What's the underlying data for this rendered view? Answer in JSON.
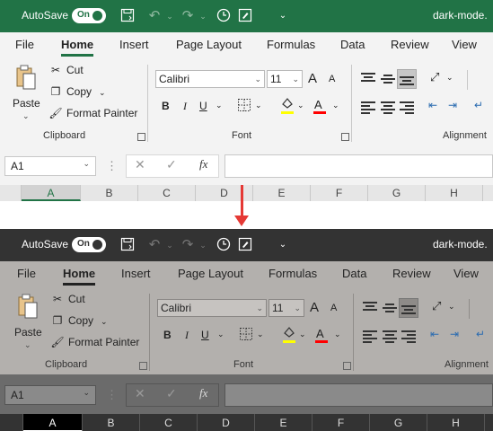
{
  "titlebar": {
    "autosave_label": "AutoSave",
    "toggle_state": "On",
    "doc_title": "dark-mode.",
    "icons": [
      "save-icon",
      "undo-icon",
      "redo-icon",
      "autorecover-clock-icon",
      "form-icon",
      "customize-qat-icon"
    ]
  },
  "tabs": [
    "File",
    "Home",
    "Insert",
    "Page Layout",
    "Formulas",
    "Data",
    "Review",
    "View"
  ],
  "active_tab": "Home",
  "clipboard": {
    "paste_label": "Paste",
    "cut_label": "Cut",
    "copy_label": "Copy",
    "format_painter_label": "Format Painter",
    "group_label": "Clipboard"
  },
  "font": {
    "font_name": "Calibri",
    "font_size": "11",
    "bold": "B",
    "italic": "I",
    "underline": "U",
    "group_label": "Font",
    "highlight_color": "#ffff00",
    "font_color": "#ff0000",
    "grow": "A",
    "shrink": "A"
  },
  "alignment": {
    "group_label": "Alignment"
  },
  "formula_bar": {
    "name_box": "A1",
    "fx": "fx",
    "cancel": "✕",
    "enter": "✓",
    "dots": "⋮"
  },
  "columns": [
    "A",
    "B",
    "C",
    "D",
    "E",
    "F",
    "G",
    "H"
  ],
  "selected_column": "A",
  "colors": {
    "light_titlebar": "#217346",
    "dark_titlebar": "#333333",
    "light_ribbon": "#f3f3f3",
    "dark_ribbon": "#b3b0ad",
    "arrow": "#e53935"
  }
}
